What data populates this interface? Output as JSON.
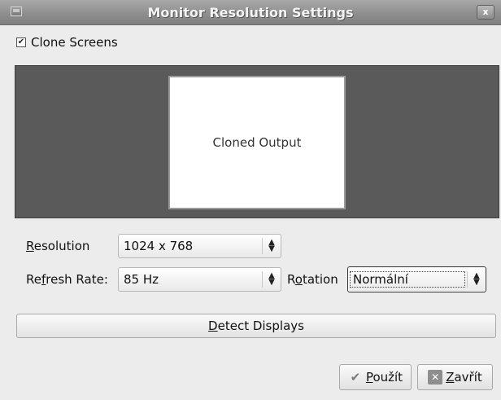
{
  "window": {
    "title": "Monitor Resolution Settings",
    "close_glyph": "x",
    "icon": "display-icon"
  },
  "clone": {
    "label": "Clone Screens",
    "checked": true,
    "check_glyph": "✔"
  },
  "preview": {
    "monitor_label": "Cloned Output"
  },
  "resolution": {
    "label_pre": "",
    "label_mnemonic": "R",
    "label_post": "esolution",
    "value": "1024 x 768"
  },
  "refresh": {
    "label_pre": "Re",
    "label_mnemonic": "f",
    "label_post": "resh Rate:",
    "value": "85 Hz"
  },
  "rotation": {
    "label_pre": "R",
    "label_mnemonic": "o",
    "label_post": "tation",
    "value": "Normální"
  },
  "combo_arrows": {
    "up": "▲",
    "down": "▼"
  },
  "detect": {
    "label_mnemonic": "D",
    "label_post": "etect Displays"
  },
  "buttons": {
    "apply": {
      "mnemonic": "P",
      "post": "oužít",
      "icon_glyph": "✔",
      "icon": "checkmark-icon"
    },
    "close": {
      "mnemonic": "Z",
      "post": "avřít",
      "icon_glyph": "✕",
      "icon": "close-icon"
    }
  }
}
